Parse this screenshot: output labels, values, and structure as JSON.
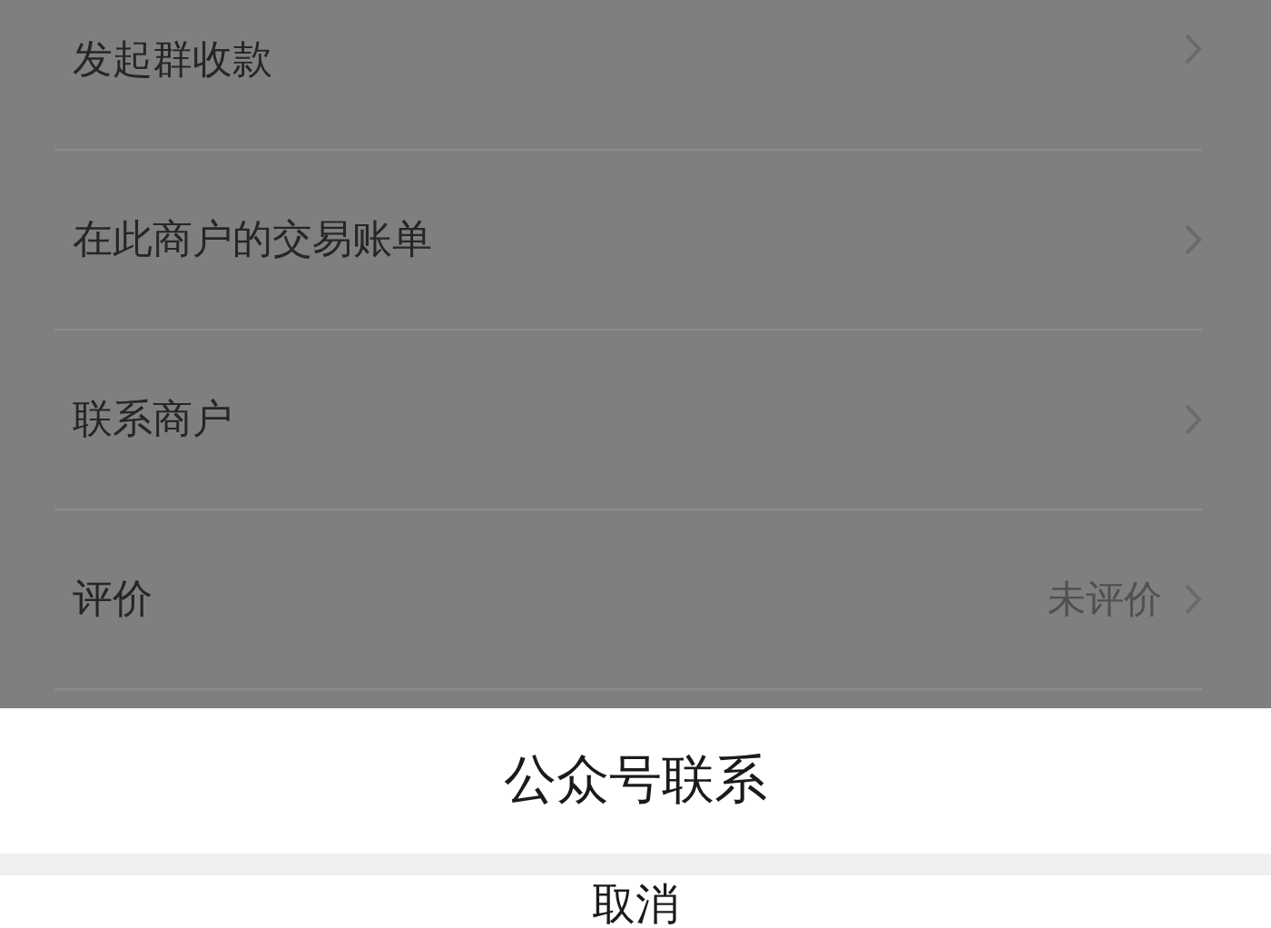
{
  "menu_rows": [
    {
      "label": "发起群收款"
    },
    {
      "label": "在此商户的交易账单"
    },
    {
      "label": "联系商户"
    },
    {
      "label": "评价",
      "value": "未评价"
    }
  ],
  "action_sheet": {
    "options": [
      "公众号联系"
    ],
    "cancel": "取消"
  }
}
